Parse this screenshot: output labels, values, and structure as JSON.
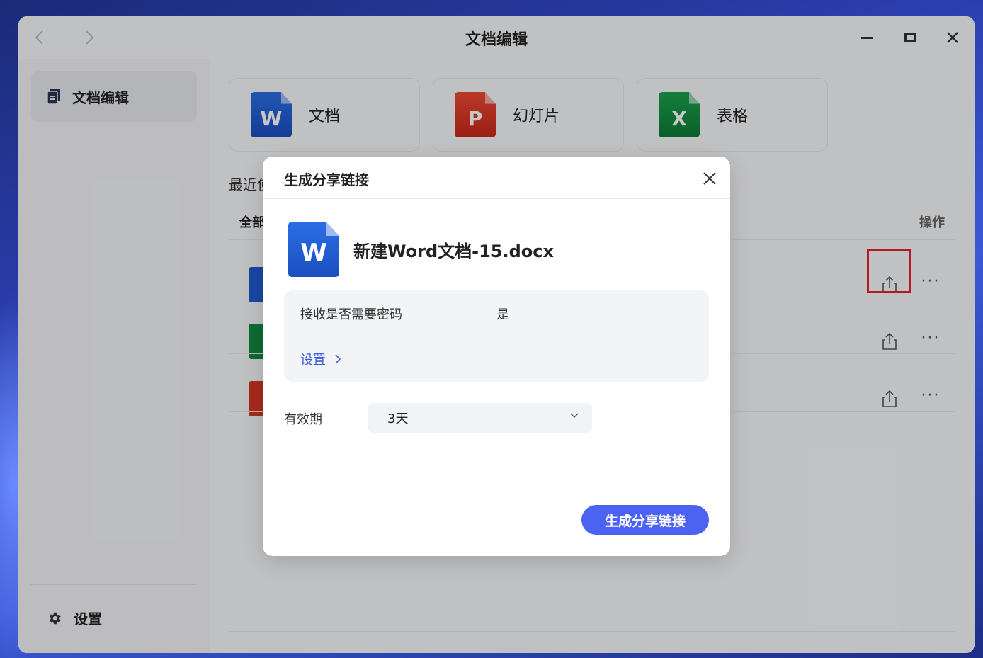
{
  "window": {
    "title": "文档编辑",
    "back_icon": "chevron-left-icon",
    "forward_icon": "chevron-right-icon"
  },
  "sidebar": {
    "active_item": {
      "label": "文档编辑",
      "icon": "document-icon"
    },
    "settings": {
      "label": "设置",
      "icon": "gear-icon"
    }
  },
  "main": {
    "cards": [
      {
        "label": "文档",
        "letter": "W",
        "type": "word"
      },
      {
        "label": "幻灯片",
        "letter": "P",
        "type": "ppt"
      },
      {
        "label": "表格",
        "letter": "X",
        "type": "xls"
      }
    ],
    "recent_label": "最近使",
    "columns": {
      "all": "全部",
      "ops": "操作"
    },
    "row_letters": [
      "W",
      "X",
      "P"
    ],
    "more_glyph": "···"
  },
  "dialog": {
    "title": "生成分享链接",
    "file_name": "新建Word文档-15.docx",
    "file_letter": "W",
    "password_label": "接收是否需要密码",
    "password_value": "是",
    "settings_link": "设置",
    "validity_label": "有效期",
    "validity_value": "3天",
    "generate_button": "生成分享链接"
  },
  "colors": {
    "accent": "#4b63f0",
    "link": "#3b5bdb",
    "highlight": "#e3222c",
    "word": "#1f5cd0",
    "ppt": "#d63524",
    "xls": "#138a3f"
  }
}
